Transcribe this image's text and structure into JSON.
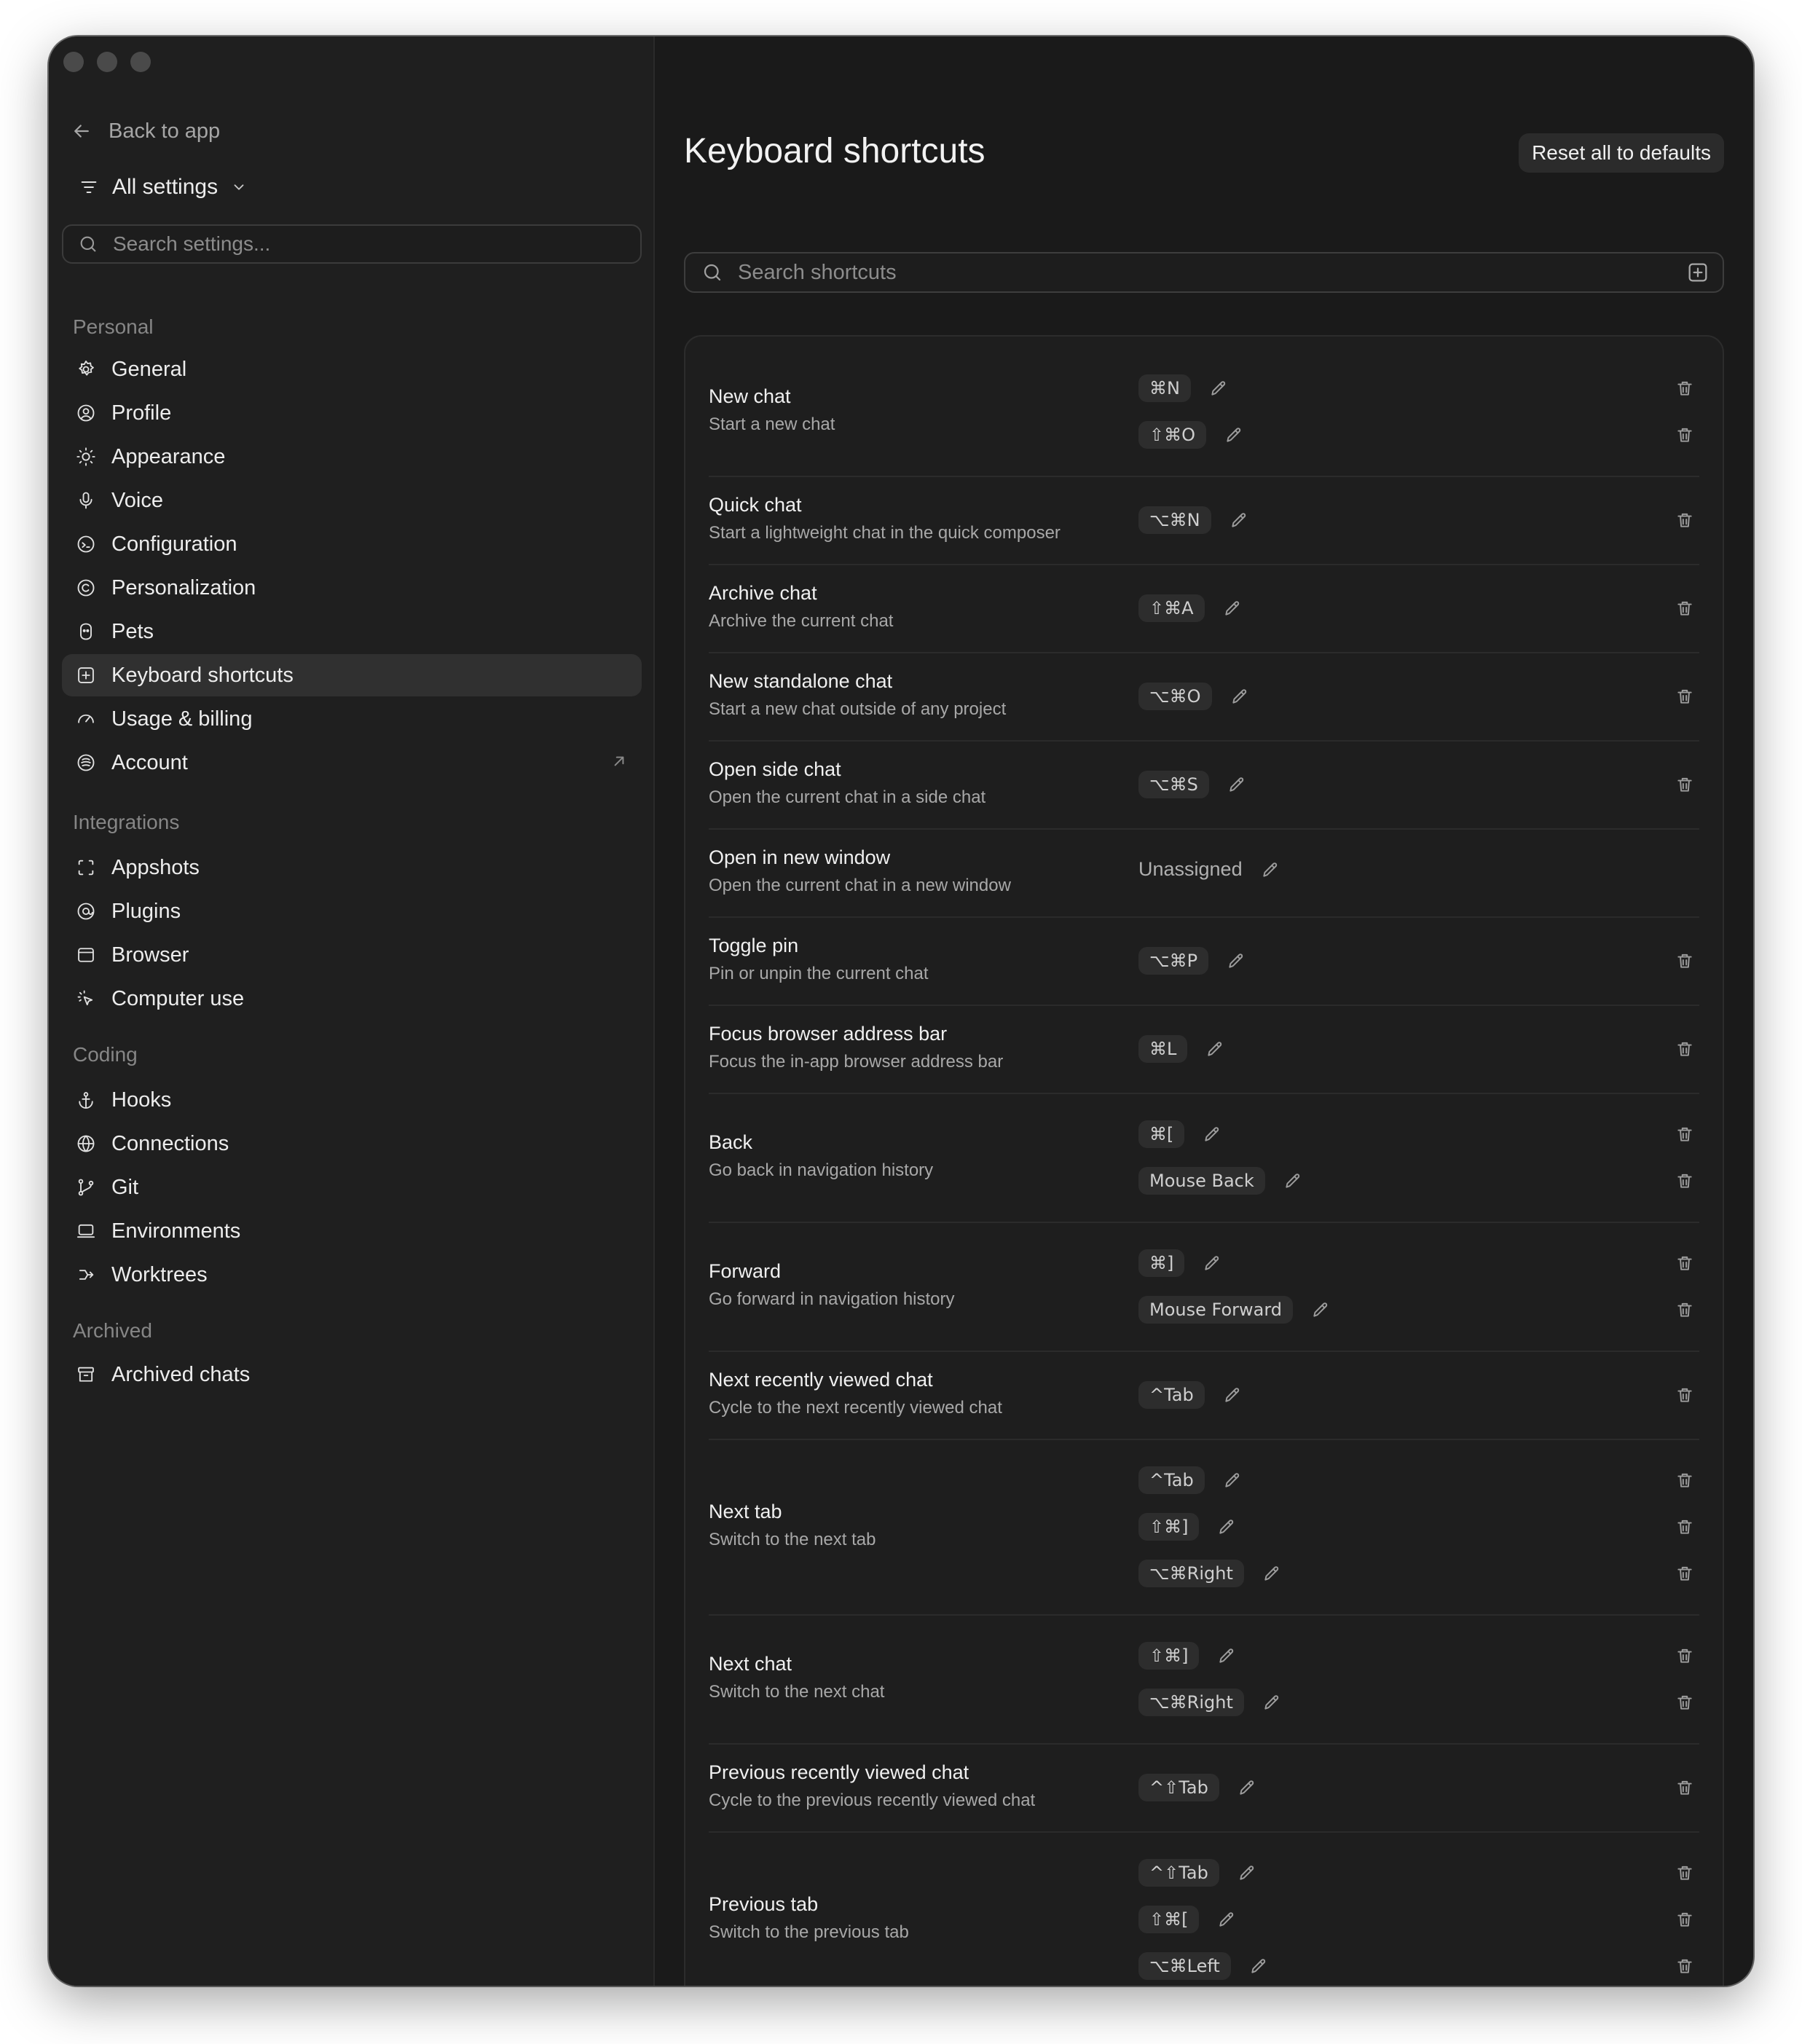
{
  "sidebar": {
    "back_label": "Back to app",
    "scope_label": "All settings",
    "search_placeholder": "Search settings...",
    "sections": [
      {
        "title": "Personal",
        "items": [
          {
            "label": "General",
            "icon": "gear-icon"
          },
          {
            "label": "Profile",
            "icon": "user-circle-icon"
          },
          {
            "label": "Appearance",
            "icon": "sun-icon"
          },
          {
            "label": "Voice",
            "icon": "microphone-icon"
          },
          {
            "label": "Configuration",
            "icon": "configuration-icon"
          },
          {
            "label": "Personalization",
            "icon": "personalization-icon"
          },
          {
            "label": "Pets",
            "icon": "pet-icon"
          },
          {
            "label": "Keyboard shortcuts",
            "icon": "keyboard-shortcut-icon",
            "active": true
          },
          {
            "label": "Usage & billing",
            "icon": "gauge-icon"
          },
          {
            "label": "Account",
            "icon": "account-icon",
            "external": true
          }
        ]
      },
      {
        "title": "Integrations",
        "items": [
          {
            "label": "Appshots",
            "icon": "capture-icon"
          },
          {
            "label": "Plugins",
            "icon": "plugin-icon"
          },
          {
            "label": "Browser",
            "icon": "browser-icon"
          },
          {
            "label": "Computer use",
            "icon": "cursor-click-icon"
          }
        ]
      },
      {
        "title": "Coding",
        "items": [
          {
            "label": "Hooks",
            "icon": "anchor-icon"
          },
          {
            "label": "Connections",
            "icon": "globe-icon"
          },
          {
            "label": "Git",
            "icon": "git-branch-icon"
          },
          {
            "label": "Environments",
            "icon": "laptop-icon"
          },
          {
            "label": "Worktrees",
            "icon": "worktree-icon"
          }
        ]
      },
      {
        "title": "Archived",
        "items": [
          {
            "label": "Archived chats",
            "icon": "archive-icon"
          }
        ]
      }
    ]
  },
  "main": {
    "title": "Keyboard shortcuts",
    "reset_label": "Reset all to defaults",
    "search_placeholder": "Search shortcuts",
    "shortcuts": [
      {
        "name": "New chat",
        "desc": "Start a new chat",
        "bindings": [
          "⌘N",
          "⇧⌘O"
        ]
      },
      {
        "name": "Quick chat",
        "desc": "Start a lightweight chat in the quick composer",
        "bindings": [
          "⌥⌘N"
        ]
      },
      {
        "name": "Archive chat",
        "desc": "Archive the current chat",
        "bindings": [
          "⇧⌘A"
        ]
      },
      {
        "name": "New standalone chat",
        "desc": "Start a new chat outside of any project",
        "bindings": [
          "⌥⌘O"
        ]
      },
      {
        "name": "Open side chat",
        "desc": "Open the current chat in a side chat",
        "bindings": [
          "⌥⌘S"
        ]
      },
      {
        "name": "Open in new window",
        "desc": "Open the current chat in a new window",
        "bindings": [],
        "unassigned_label": "Unassigned"
      },
      {
        "name": "Toggle pin",
        "desc": "Pin or unpin the current chat",
        "bindings": [
          "⌥⌘P"
        ]
      },
      {
        "name": "Focus browser address bar",
        "desc": "Focus the in-app browser address bar",
        "bindings": [
          "⌘L"
        ]
      },
      {
        "name": "Back",
        "desc": "Go back in navigation history",
        "bindings": [
          "⌘[",
          "Mouse Back"
        ]
      },
      {
        "name": "Forward",
        "desc": "Go forward in navigation history",
        "bindings": [
          "⌘]",
          "Mouse Forward"
        ]
      },
      {
        "name": "Next recently viewed chat",
        "desc": "Cycle to the next recently viewed chat",
        "bindings": [
          "^Tab"
        ]
      },
      {
        "name": "Next tab",
        "desc": "Switch to the next tab",
        "bindings": [
          "^Tab",
          "⇧⌘]",
          "⌥⌘Right"
        ]
      },
      {
        "name": "Next chat",
        "desc": "Switch to the next chat",
        "bindings": [
          "⇧⌘]",
          "⌥⌘Right"
        ]
      },
      {
        "name": "Previous recently viewed chat",
        "desc": "Cycle to the previous recently viewed chat",
        "bindings": [
          "^⇧Tab"
        ]
      },
      {
        "name": "Previous tab",
        "desc": "Switch to the previous tab",
        "bindings": [
          "^⇧Tab",
          "⇧⌘[",
          "⌥⌘Left"
        ]
      }
    ]
  }
}
